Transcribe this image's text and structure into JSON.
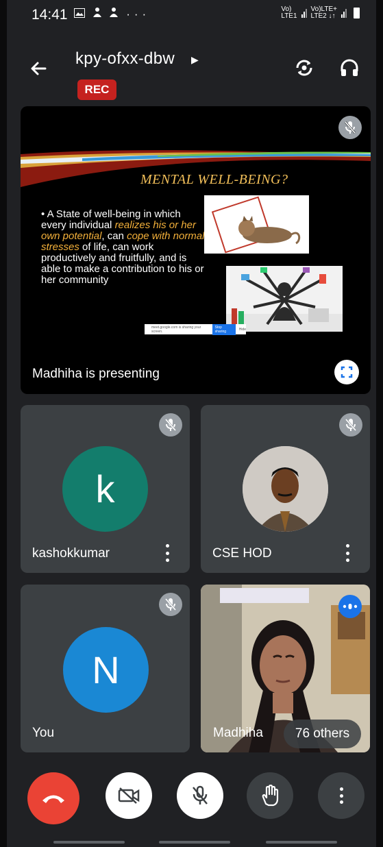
{
  "status_bar": {
    "time": "14:41",
    "left_icons": [
      "gallery-icon",
      "person-icon",
      "person-icon"
    ],
    "overflow": "···",
    "sim1": "Vo)\nLTE1",
    "sim2": "Vo)LTE+\nLTE2 ↓↑"
  },
  "header": {
    "meeting_code": "kpy-ofxx-dbw",
    "rec_label": "REC",
    "icons": [
      "back-arrow-icon",
      "switch-camera-icon",
      "headphones-icon"
    ]
  },
  "presentation": {
    "label": "Madhiha is presenting",
    "slide": {
      "title": "MENTAL WELL-BEING?",
      "bullet_parts": [
        {
          "text": "• A State of well-being in which every individual ",
          "highlight": false
        },
        {
          "text": "realizes his or her own potential",
          "highlight": true
        },
        {
          "text": ", can ",
          "highlight": false
        },
        {
          "text": "cope with normal stresses",
          "highlight": true
        },
        {
          "text": " of life, can work productively and fruitfully, and is able to make a contribution to his or her community",
          "highlight": false
        }
      ],
      "share_text": "meet.google.com is sharing your screen.",
      "share_stop": "Stop sharing",
      "share_hide": "Hide"
    }
  },
  "participants": [
    {
      "name": "kashokkumar",
      "initial": "k",
      "avatar_color": "#137d6c",
      "muted": true
    },
    {
      "name": "CSE HOD",
      "initial": "",
      "avatar_color": "#7a5a45",
      "muted": true
    },
    {
      "name": "You",
      "initial": "N",
      "avatar_color": "#1a88d4",
      "muted": true
    },
    {
      "name": "Madhiha",
      "initial": "",
      "avatar_color": "",
      "muted": false,
      "speaking": true
    }
  ],
  "others_chip": "76 others",
  "controls": {
    "colors": {
      "end_call": "#ea4335",
      "light": "#ffffff",
      "dark": "#3c4043"
    },
    "icons": [
      "end-call-icon",
      "camera-off-icon",
      "mic-off-icon",
      "raise-hand-icon",
      "more-icon"
    ]
  }
}
